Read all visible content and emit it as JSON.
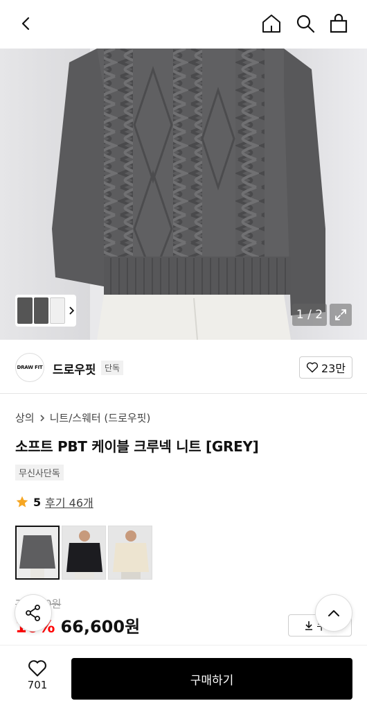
{
  "topbar": {
    "icons": [
      "back-icon",
      "home-icon",
      "search-icon",
      "shopping-bag-icon"
    ]
  },
  "gallery": {
    "counter": "1 / 2"
  },
  "brand": {
    "logo_text": "DRAW FIT",
    "name": "드로우핏",
    "badge": "단독",
    "likes": "23만"
  },
  "product": {
    "breadcrumb": [
      "상의",
      "니트/스웨터 (드로우핏)"
    ],
    "title": "소프트 PBT 케이블 크루넥 니트 [GREY]",
    "tag": "무신사단독",
    "rating": "5",
    "reviews": "후기 46개",
    "color_options": [
      "GREY",
      "BLACK",
      "CREAM"
    ],
    "original_price": "74,000원",
    "discount_rate": "10%",
    "sale_price": "66,600원",
    "coupon_label": "쿠폰"
  },
  "bottom": {
    "wish_count": "701",
    "buy_label": "구매하기"
  },
  "colors": {
    "accent": "#000000",
    "discount": "#ff0000",
    "star": "#f6a623"
  }
}
